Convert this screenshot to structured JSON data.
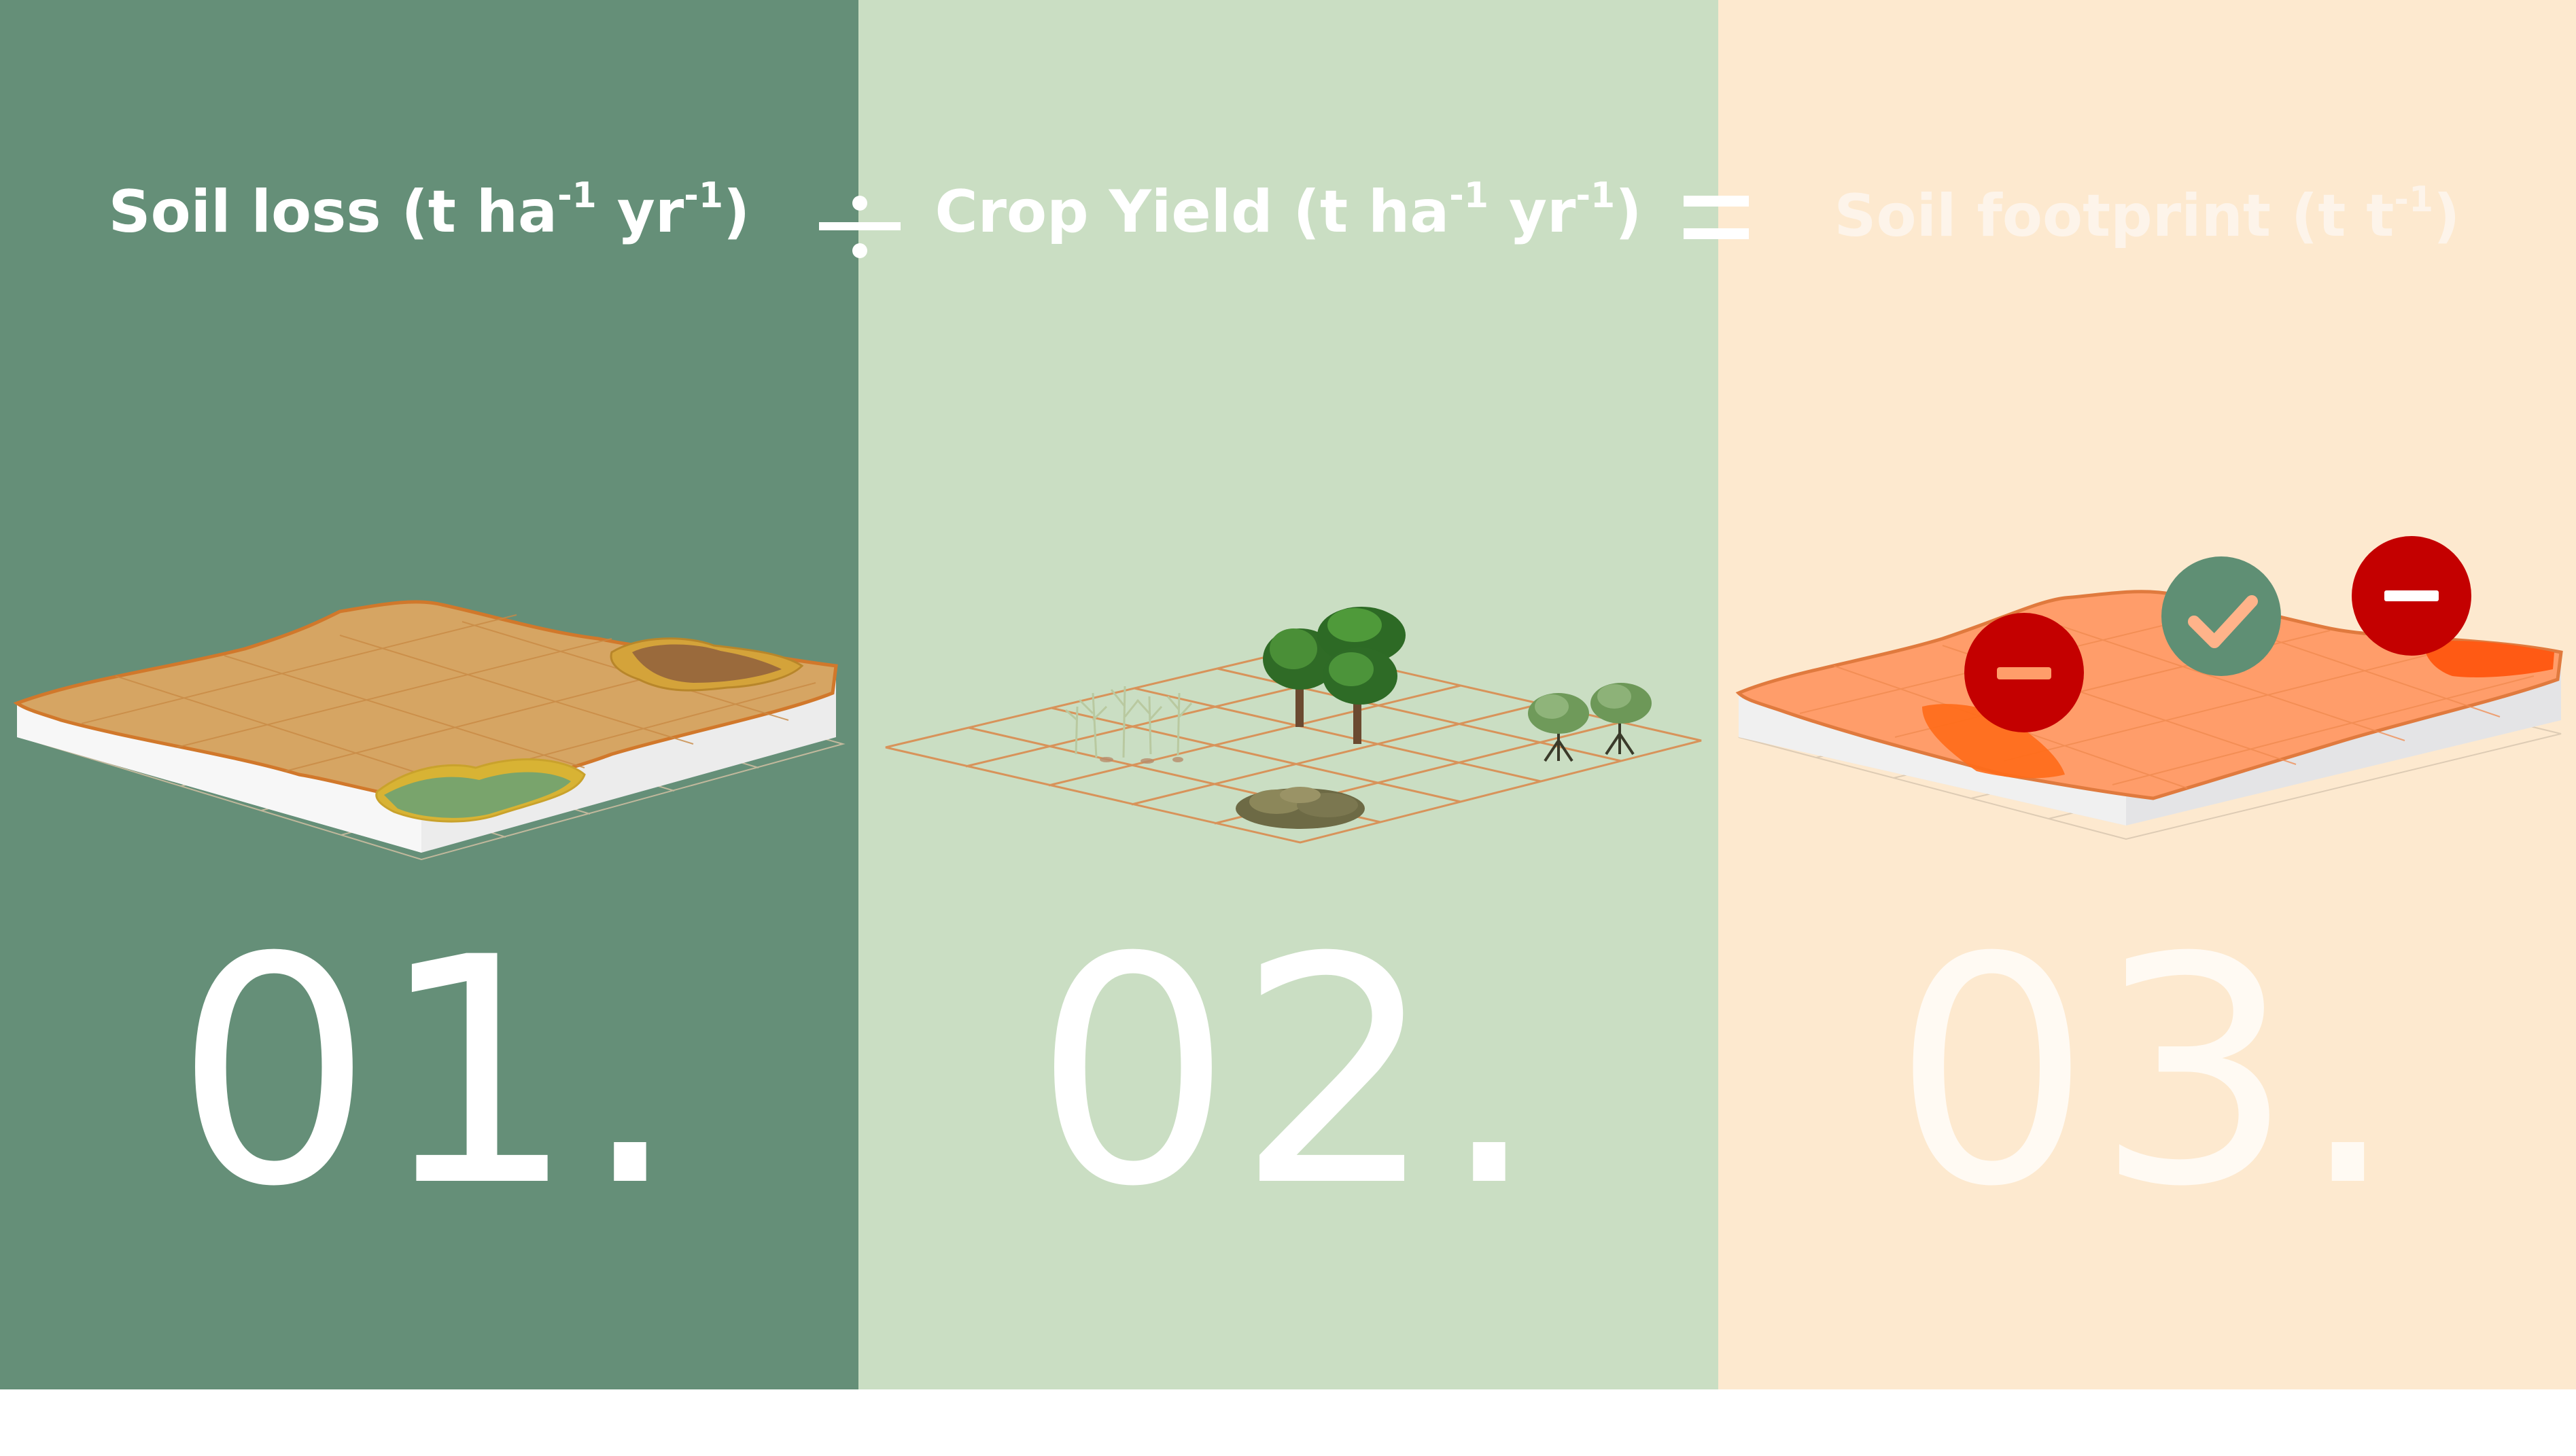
{
  "steps": [
    {
      "title_main": "Soil loss (t ha",
      "sup1": "-1",
      "mid": " yr",
      "sup2": "-1",
      "end": ")",
      "number": "01."
    },
    {
      "title_main": "Crop Yield (t ha",
      "sup1": "-1",
      "mid": " yr",
      "sup2": "-1",
      "end": ")",
      "number": "02."
    },
    {
      "title_main": "Soil footprint (t t",
      "sup1": "-1",
      "mid": "",
      "sup2": "",
      "end": ")",
      "number": "03."
    }
  ],
  "operators": [
    "divide-sign",
    "equals-sign"
  ],
  "colors": {
    "panel1": "#658f78",
    "panel2": "#cadec3",
    "panel3": "#fde9cf",
    "soil": "#d6a563",
    "footprint": "#ff9d6a",
    "badge_red": "#c40000",
    "badge_green": "#5f8f74"
  },
  "icons": [
    "minus-badge-icon",
    "check-badge-icon",
    "minus-badge-icon"
  ]
}
